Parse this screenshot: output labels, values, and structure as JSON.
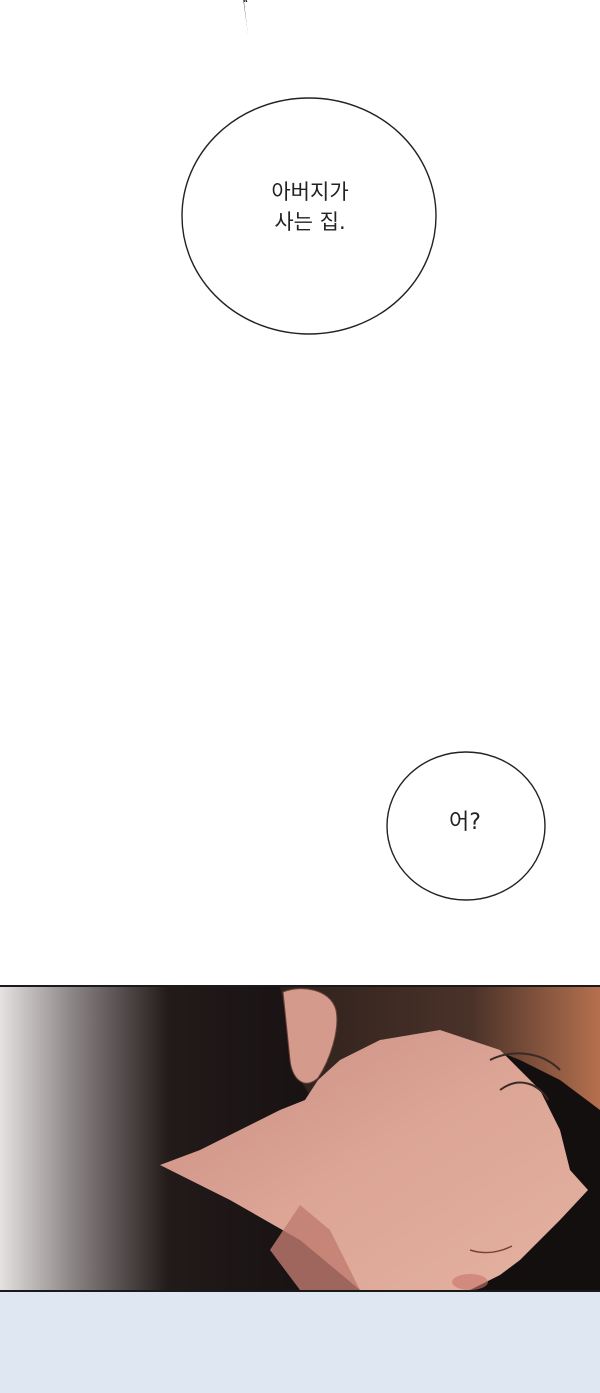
{
  "bubbles": [
    {
      "text": "아버지가\n사는 집."
    },
    {
      "text": "어?"
    }
  ],
  "colors": {
    "background": "#ffffff",
    "skin": "#d9a091",
    "hair": "#3b2a23",
    "shadow_gradient_dark": "#151010",
    "bottom_panel": "#dfe7f3"
  }
}
